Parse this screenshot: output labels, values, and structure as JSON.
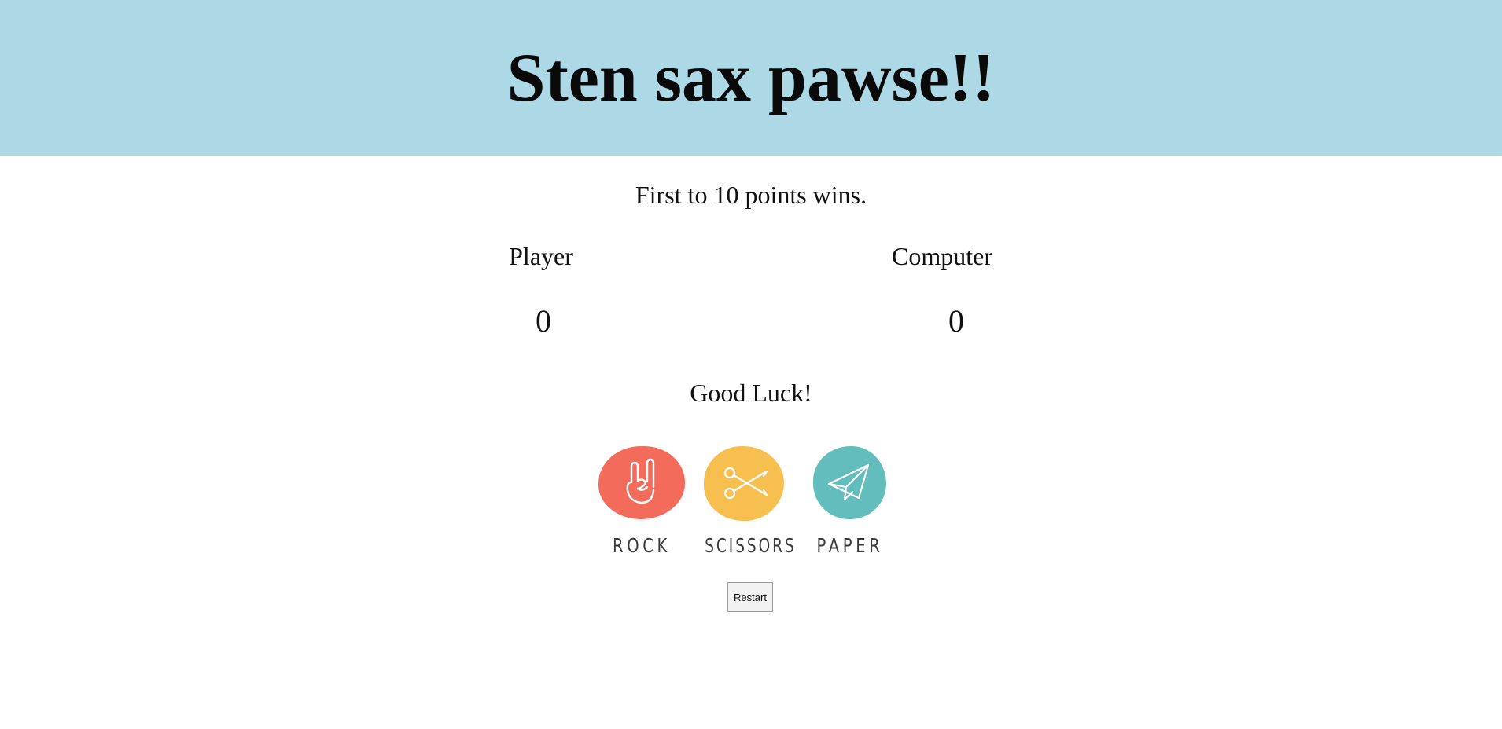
{
  "header": {
    "title": "Sten sax pawse!!",
    "background_color": "#add8e6"
  },
  "rules": {
    "text": "First to 10 points wins."
  },
  "scoreboard": {
    "player": {
      "label": "Player",
      "score": "0"
    },
    "computer": {
      "label": "Computer",
      "score": "0"
    }
  },
  "status": {
    "message": "Good Luck!"
  },
  "choices": [
    {
      "label": "ROCK",
      "icon": "rock-hand-icon",
      "color": "#f26b5b"
    },
    {
      "label": "SCISSORS",
      "icon": "scissors-icon",
      "color": "#f6bf4f"
    },
    {
      "label": "PAPER",
      "icon": "paper-plane-icon",
      "color": "#63bdbd"
    }
  ],
  "controls": {
    "restart_label": "Restart"
  }
}
